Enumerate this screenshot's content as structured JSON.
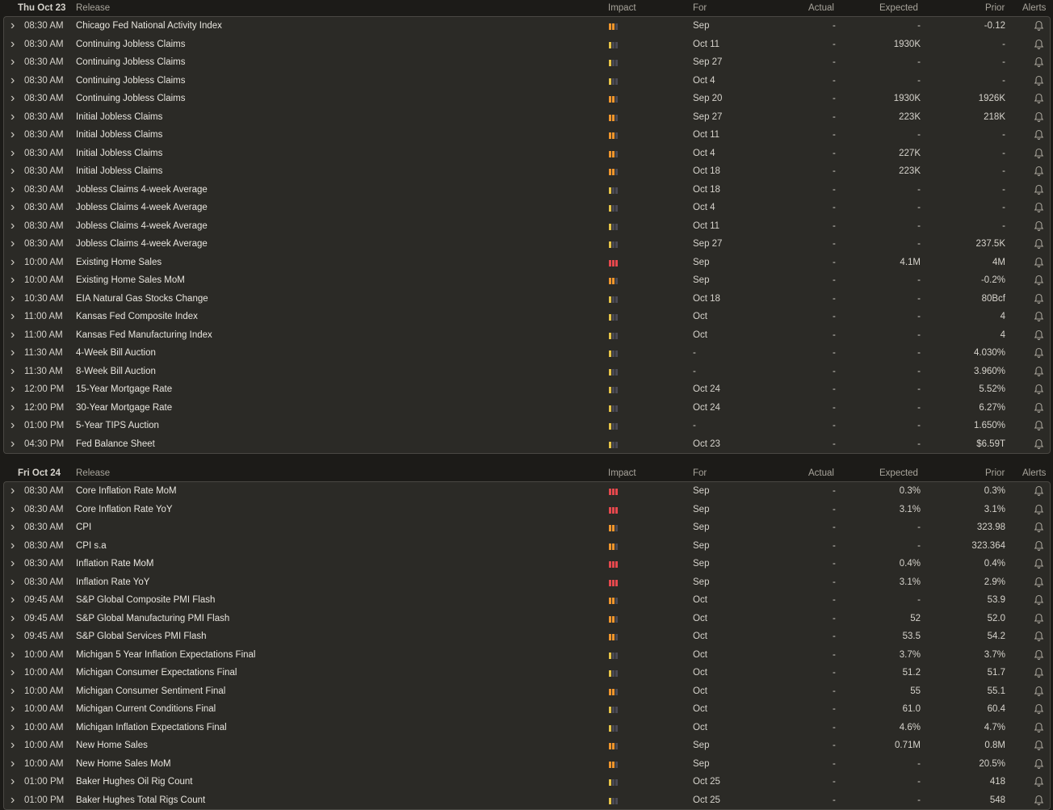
{
  "columns": {
    "release": "Release",
    "impact": "Impact",
    "for": "For",
    "actual": "Actual",
    "expected": "Expected",
    "prior": "Prior",
    "alerts": "Alerts"
  },
  "days": [
    {
      "day_label": "Thu Oct 23",
      "rows": [
        {
          "time": "08:30 AM",
          "name": "Chicago Fed National Activity Index",
          "impact": 2,
          "for": "Sep",
          "actual": "-",
          "expected": "-",
          "prior": "-0.12"
        },
        {
          "time": "08:30 AM",
          "name": "Continuing Jobless Claims",
          "impact": 1,
          "for": "Oct 11",
          "actual": "-",
          "expected": "1930K",
          "prior": "-"
        },
        {
          "time": "08:30 AM",
          "name": "Continuing Jobless Claims",
          "impact": 1,
          "for": "Sep 27",
          "actual": "-",
          "expected": "-",
          "prior": "-"
        },
        {
          "time": "08:30 AM",
          "name": "Continuing Jobless Claims",
          "impact": 1,
          "for": "Oct 4",
          "actual": "-",
          "expected": "-",
          "prior": "-"
        },
        {
          "time": "08:30 AM",
          "name": "Continuing Jobless Claims",
          "impact": 2,
          "for": "Sep 20",
          "actual": "-",
          "expected": "1930K",
          "prior": "1926K"
        },
        {
          "time": "08:30 AM",
          "name": "Initial Jobless Claims",
          "impact": 2,
          "for": "Sep 27",
          "actual": "-",
          "expected": "223K",
          "prior": "218K"
        },
        {
          "time": "08:30 AM",
          "name": "Initial Jobless Claims",
          "impact": 2,
          "for": "Oct 11",
          "actual": "-",
          "expected": "-",
          "prior": "-"
        },
        {
          "time": "08:30 AM",
          "name": "Initial Jobless Claims",
          "impact": 2,
          "for": "Oct 4",
          "actual": "-",
          "expected": "227K",
          "prior": "-"
        },
        {
          "time": "08:30 AM",
          "name": "Initial Jobless Claims",
          "impact": 2,
          "for": "Oct 18",
          "actual": "-",
          "expected": "223K",
          "prior": "-"
        },
        {
          "time": "08:30 AM",
          "name": "Jobless Claims 4-week Average",
          "impact": 1,
          "for": "Oct 18",
          "actual": "-",
          "expected": "-",
          "prior": "-"
        },
        {
          "time": "08:30 AM",
          "name": "Jobless Claims 4-week Average",
          "impact": 1,
          "for": "Oct 4",
          "actual": "-",
          "expected": "-",
          "prior": "-"
        },
        {
          "time": "08:30 AM",
          "name": "Jobless Claims 4-week Average",
          "impact": 1,
          "for": "Oct 11",
          "actual": "-",
          "expected": "-",
          "prior": "-"
        },
        {
          "time": "08:30 AM",
          "name": "Jobless Claims 4-week Average",
          "impact": 1,
          "for": "Sep 27",
          "actual": "-",
          "expected": "-",
          "prior": "237.5K"
        },
        {
          "time": "10:00 AM",
          "name": "Existing Home Sales",
          "impact": 3,
          "for": "Sep",
          "actual": "-",
          "expected": "4.1M",
          "prior": "4M"
        },
        {
          "time": "10:00 AM",
          "name": "Existing Home Sales MoM",
          "impact": 2,
          "for": "Sep",
          "actual": "-",
          "expected": "-",
          "prior": "-0.2%"
        },
        {
          "time": "10:30 AM",
          "name": "EIA Natural Gas Stocks Change",
          "impact": 1,
          "for": "Oct 18",
          "actual": "-",
          "expected": "-",
          "prior": "80Bcf"
        },
        {
          "time": "11:00 AM",
          "name": "Kansas Fed Composite Index",
          "impact": 1,
          "for": "Oct",
          "actual": "-",
          "expected": "-",
          "prior": "4"
        },
        {
          "time": "11:00 AM",
          "name": "Kansas Fed Manufacturing Index",
          "impact": 1,
          "for": "Oct",
          "actual": "-",
          "expected": "-",
          "prior": "4"
        },
        {
          "time": "11:30 AM",
          "name": "4-Week Bill Auction",
          "impact": 1,
          "for": "-",
          "actual": "-",
          "expected": "-",
          "prior": "4.030%"
        },
        {
          "time": "11:30 AM",
          "name": "8-Week Bill Auction",
          "impact": 1,
          "for": "-",
          "actual": "-",
          "expected": "-",
          "prior": "3.960%"
        },
        {
          "time": "12:00 PM",
          "name": "15-Year Mortgage Rate",
          "impact": 1,
          "for": "Oct 24",
          "actual": "-",
          "expected": "-",
          "prior": "5.52%"
        },
        {
          "time": "12:00 PM",
          "name": "30-Year Mortgage Rate",
          "impact": 1,
          "for": "Oct 24",
          "actual": "-",
          "expected": "-",
          "prior": "6.27%"
        },
        {
          "time": "01:00 PM",
          "name": "5-Year TIPS Auction",
          "impact": 1,
          "for": "-",
          "actual": "-",
          "expected": "-",
          "prior": "1.650%"
        },
        {
          "time": "04:30 PM",
          "name": "Fed Balance Sheet",
          "impact": 1,
          "for": "Oct 23",
          "actual": "-",
          "expected": "-",
          "prior": "$6.59T"
        }
      ]
    },
    {
      "day_label": "Fri Oct 24",
      "rows": [
        {
          "time": "08:30 AM",
          "name": "Core Inflation Rate MoM",
          "impact": 3,
          "for": "Sep",
          "actual": "-",
          "expected": "0.3%",
          "prior": "0.3%"
        },
        {
          "time": "08:30 AM",
          "name": "Core Inflation Rate YoY",
          "impact": 3,
          "for": "Sep",
          "actual": "-",
          "expected": "3.1%",
          "prior": "3.1%"
        },
        {
          "time": "08:30 AM",
          "name": "CPI",
          "impact": 2,
          "for": "Sep",
          "actual": "-",
          "expected": "-",
          "prior": "323.98"
        },
        {
          "time": "08:30 AM",
          "name": "CPI s.a",
          "impact": 2,
          "for": "Sep",
          "actual": "-",
          "expected": "-",
          "prior": "323.364"
        },
        {
          "time": "08:30 AM",
          "name": "Inflation Rate MoM",
          "impact": 3,
          "for": "Sep",
          "actual": "-",
          "expected": "0.4%",
          "prior": "0.4%"
        },
        {
          "time": "08:30 AM",
          "name": "Inflation Rate YoY",
          "impact": 3,
          "for": "Sep",
          "actual": "-",
          "expected": "3.1%",
          "prior": "2.9%"
        },
        {
          "time": "09:45 AM",
          "name": "S&P Global Composite PMI Flash",
          "impact": 2,
          "for": "Oct",
          "actual": "-",
          "expected": "-",
          "prior": "53.9"
        },
        {
          "time": "09:45 AM",
          "name": "S&P Global Manufacturing PMI Flash",
          "impact": 2,
          "for": "Oct",
          "actual": "-",
          "expected": "52",
          "prior": "52.0"
        },
        {
          "time": "09:45 AM",
          "name": "S&P Global Services PMI Flash",
          "impact": 2,
          "for": "Oct",
          "actual": "-",
          "expected": "53.5",
          "prior": "54.2"
        },
        {
          "time": "10:00 AM",
          "name": "Michigan 5 Year Inflation Expectations Final",
          "impact": 1,
          "for": "Oct",
          "actual": "-",
          "expected": "3.7%",
          "prior": "3.7%"
        },
        {
          "time": "10:00 AM",
          "name": "Michigan Consumer Expectations Final",
          "impact": 1,
          "for": "Oct",
          "actual": "-",
          "expected": "51.2",
          "prior": "51.7"
        },
        {
          "time": "10:00 AM",
          "name": "Michigan Consumer Sentiment Final",
          "impact": 2,
          "for": "Oct",
          "actual": "-",
          "expected": "55",
          "prior": "55.1"
        },
        {
          "time": "10:00 AM",
          "name": "Michigan Current Conditions Final",
          "impact": 1,
          "for": "Oct",
          "actual": "-",
          "expected": "61.0",
          "prior": "60.4"
        },
        {
          "time": "10:00 AM",
          "name": "Michigan Inflation Expectations Final",
          "impact": 1,
          "for": "Oct",
          "actual": "-",
          "expected": "4.6%",
          "prior": "4.7%"
        },
        {
          "time": "10:00 AM",
          "name": "New Home Sales",
          "impact": 2,
          "for": "Sep",
          "actual": "-",
          "expected": "0.71M",
          "prior": "0.8M"
        },
        {
          "time": "10:00 AM",
          "name": "New Home Sales MoM",
          "impact": 2,
          "for": "Sep",
          "actual": "-",
          "expected": "-",
          "prior": "20.5%"
        },
        {
          "time": "01:00 PM",
          "name": "Baker Hughes Oil Rig Count",
          "impact": 1,
          "for": "Oct 25",
          "actual": "-",
          "expected": "-",
          "prior": "418"
        },
        {
          "time": "01:00 PM",
          "name": "Baker Hughes Total Rigs Count",
          "impact": 1,
          "for": "Oct 25",
          "actual": "-",
          "expected": "-",
          "prior": "548"
        }
      ]
    }
  ],
  "icons": {
    "expand": "chevron-right-icon",
    "alert": "bell-icon"
  },
  "colors": {
    "impact_low": "#e8c547",
    "impact_medium": "#f0962d",
    "impact_high": "#e5484d",
    "impact_off": "#4a4a55"
  }
}
